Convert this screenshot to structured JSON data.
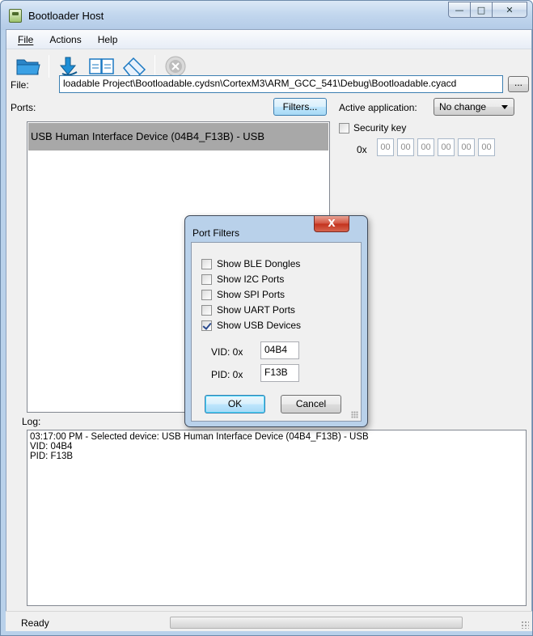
{
  "window": {
    "title": "Bootloader Host",
    "caption_buttons": {
      "minimize": "—",
      "maximize": "□",
      "close": "✕"
    }
  },
  "menu": {
    "file_label": "File",
    "actions_label": "Actions",
    "help_label": "Help"
  },
  "toolbar": {
    "icons": [
      "open-folder-icon",
      "program-download-icon",
      "verify-icon",
      "erase-icon",
      "abort-icon"
    ]
  },
  "file": {
    "label": "File:",
    "path": "loadable Project\\Bootloadable.cydsn\\CortexM3\\ARM_GCC_541\\Debug\\Bootloadable.cyacd",
    "browse_label": "..."
  },
  "ports": {
    "label": "Ports:",
    "filters_label": "Filters...",
    "items": [
      "USB Human Interface Device (04B4_F13B) - USB"
    ]
  },
  "active_app": {
    "label": "Active application:",
    "value": "No change"
  },
  "security": {
    "label": "Security key",
    "checked": false,
    "prefix": "0x",
    "bytes": [
      "00",
      "00",
      "00",
      "00",
      "00",
      "00"
    ]
  },
  "log": {
    "label": "Log:",
    "lines": [
      "03:17:00 PM - Selected device: USB Human Interface Device (04B4_F13B) - USB",
      "VID: 04B4",
      "PID: F13B"
    ]
  },
  "status": {
    "text": "Ready"
  },
  "dialog": {
    "title": "Port Filters",
    "close_label": "X",
    "options": [
      {
        "label": "Show BLE Dongles",
        "checked": false
      },
      {
        "label": "Show I2C Ports",
        "checked": false
      },
      {
        "label": "Show SPI Ports",
        "checked": false
      },
      {
        "label": "Show UART Ports",
        "checked": false
      },
      {
        "label": "Show USB Devices",
        "checked": true
      }
    ],
    "vid_label": "VID: 0x",
    "vid_value": "04B4",
    "pid_label": "PID: 0x",
    "pid_value": "F13B",
    "ok_label": "OK",
    "cancel_label": "Cancel"
  }
}
